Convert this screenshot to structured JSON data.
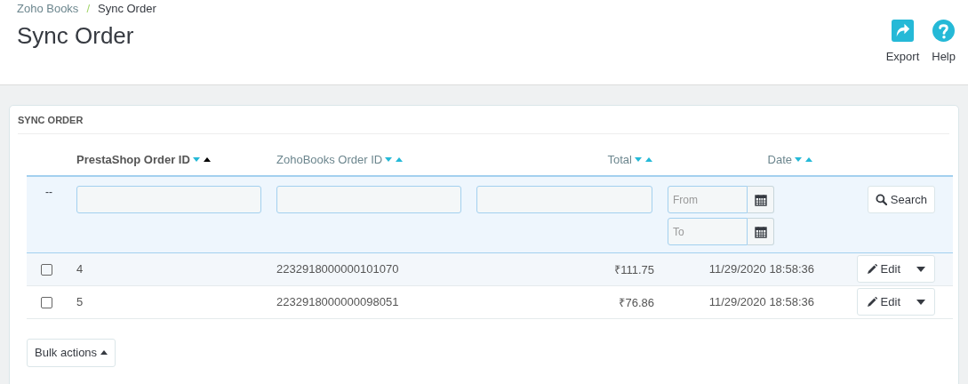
{
  "breadcrumb": [
    "Zoho Books",
    "/",
    "Sync Order"
  ],
  "page_title": "Sync Order",
  "toolbar": [
    {
      "kind": "export",
      "label": "Export"
    },
    {
      "kind": "help",
      "label": "Help"
    }
  ],
  "panel": {
    "title": "SYNC ORDER",
    "columns": [
      {
        "label": "PrestaShop Order ID",
        "sorted": true
      },
      {
        "label": "ZohoBooks Order ID",
        "sorted": false
      },
      {
        "label": "Total",
        "sorted": false
      },
      {
        "label": "Date",
        "sorted": false
      }
    ],
    "filters": {
      "marker": "--",
      "date_from": {
        "placeholder": "From"
      },
      "date_to": {
        "placeholder": "To"
      },
      "search_button": "Search"
    },
    "rows": [
      {
        "checked": false,
        "highlighted": true,
        "prestashop_order_id": "4",
        "zohobooks_order_id": "2232918000000101070",
        "total": "₹111.75",
        "date": "11/29/2020 18:58:36",
        "action": "Edit"
      },
      {
        "checked": false,
        "highlighted": false,
        "prestashop_order_id": "5",
        "zohobooks_order_id": "2232918000000098051",
        "total": "₹76.86",
        "date": "11/29/2020 18:58:36",
        "action": "Edit"
      }
    ],
    "bulk_actions": "Bulk actions"
  }
}
